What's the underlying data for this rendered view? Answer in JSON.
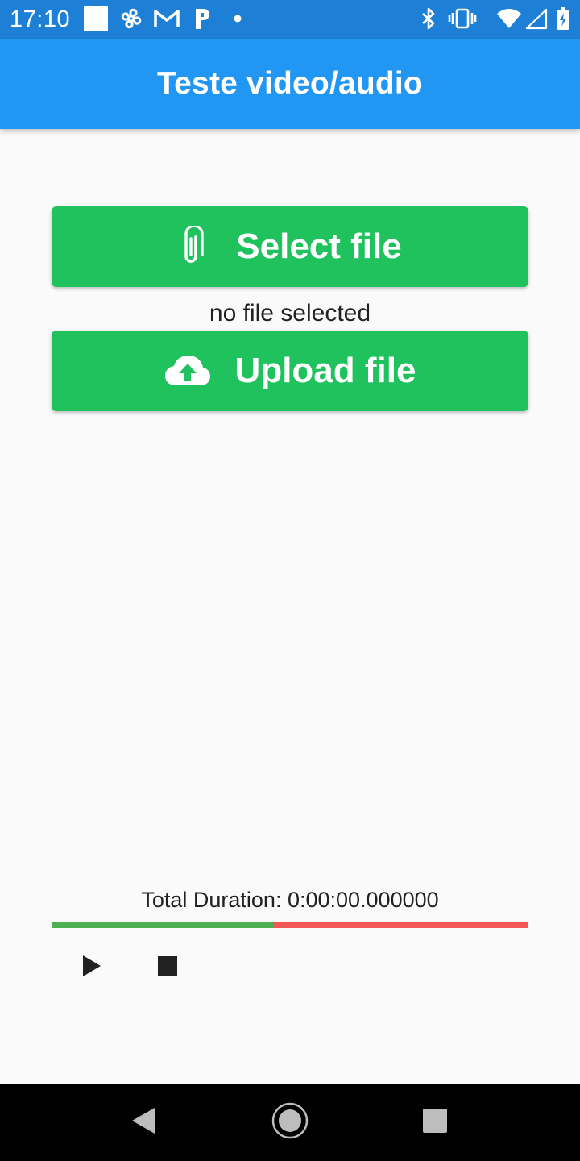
{
  "status_bar": {
    "time": "17:10",
    "icons": [
      "notification-square-icon",
      "fan-icon",
      "gmail-icon",
      "parking-icon",
      "dot-icon",
      "bluetooth-icon",
      "vibrate-icon",
      "wifi-icon",
      "wifi-outline-icon",
      "battery-icon"
    ]
  },
  "app_bar": {
    "title": "Teste video/audio"
  },
  "buttons": {
    "select_label": "Select file",
    "select_icon": "paperclip-icon",
    "upload_label": "Upload file",
    "upload_icon": "cloud-upload-icon"
  },
  "file_status": "no file selected",
  "player": {
    "duration_text": "Total Duration: 0:00:00.000000",
    "progress_fraction": 0.466,
    "progress_played_color": "#4caf50",
    "progress_remaining_color": "#f25757",
    "controls": [
      "play-icon",
      "stop-icon"
    ]
  },
  "nav_bar": {
    "icons": [
      "back-icon",
      "home-icon",
      "recents-icon"
    ]
  },
  "colors": {
    "status_bar": "#1e7fd6",
    "app_bar": "#2196f3",
    "button": "#20c25e",
    "background": "#fafafa"
  }
}
